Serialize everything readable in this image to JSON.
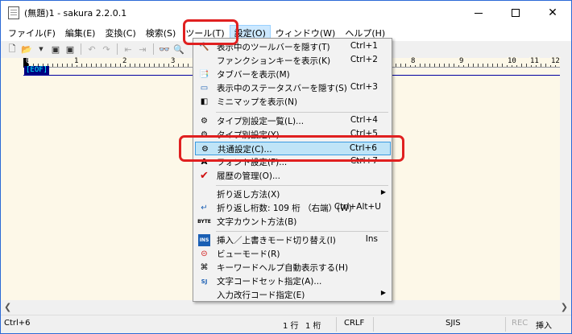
{
  "window": {
    "title": "(無題)1 - sakura 2.2.0.1"
  },
  "menubar": [
    "ファイル(F)",
    "編集(E)",
    "変換(C)",
    "検索(S)",
    "ツール(T)",
    "設定(O)",
    "ウィンドウ(W)",
    "ヘルプ(H)"
  ],
  "ruler": {
    "labels": [
      "0",
      "1",
      "2",
      "3",
      "8",
      "9",
      "10",
      "11",
      "12"
    ]
  },
  "editor": {
    "eof": "[EOF]"
  },
  "settings_menu": {
    "items": [
      {
        "label": "表示中のツールバーを隠す(T)",
        "shortcut": "Ctrl+1",
        "icon": "toolbar-icon"
      },
      {
        "label": "ファンクションキーを表示(K)",
        "shortcut": "Ctrl+2",
        "icon": ""
      },
      {
        "label": "タブバーを表示(M)",
        "shortcut": "",
        "icon": "tabbar-icon"
      },
      {
        "label": "表示中のステータスバーを隠す(S)",
        "shortcut": "Ctrl+3",
        "icon": "statusbar-icon"
      },
      {
        "label": "ミニマップを表示(N)",
        "shortcut": "",
        "icon": "minimap-icon"
      },
      {
        "label": "タイプ別設定一覧(L)...",
        "shortcut": "Ctrl+4",
        "icon": "type-list-icon"
      },
      {
        "label": "タイプ別設定(Y)...",
        "shortcut": "Ctrl+5",
        "icon": "type-settings-icon"
      },
      {
        "label": "共通設定(C)...",
        "shortcut": "Ctrl+6",
        "icon": "common-settings-icon"
      },
      {
        "label": "フォント設定(F)...",
        "shortcut": "Ctrl+7",
        "icon": "font-icon"
      },
      {
        "label": "履歴の管理(O)...",
        "shortcut": "",
        "icon": "checkmark-icon"
      },
      {
        "label": "折り返し方法(X)",
        "shortcut": "",
        "icon": "",
        "submenu": true
      },
      {
        "label": "折り返し桁数: 109 桁 （右端）(W)",
        "shortcut": "Ctrl+Alt+U",
        "icon": "wrap-icon"
      },
      {
        "label": "文字カウント方法(B)",
        "shortcut": "",
        "icon": "byte-icon"
      },
      {
        "label": "挿入／上書きモード切り替え(I)",
        "shortcut": "Ins",
        "icon": "ins-icon"
      },
      {
        "label": "ビューモード(R)",
        "shortcut": "",
        "icon": "viewmode-icon"
      },
      {
        "label": "キーワードヘルプ自動表示する(H)",
        "shortcut": "",
        "icon": "keyword-help-icon"
      },
      {
        "label": "文字コードセット指定(A)...",
        "shortcut": "",
        "icon": "charset-icon"
      },
      {
        "label": "入力改行コード指定(E)",
        "shortcut": "",
        "icon": "",
        "submenu": true
      }
    ],
    "highlighted_index": 7
  },
  "statusbar": {
    "message": "Ctrl+6",
    "line": "1 行",
    "col": "1 桁",
    "eol": "CRLF",
    "encoding": "SJIS",
    "rec": "REC",
    "mode": "挿入"
  },
  "colors": {
    "annotation": "#e02020",
    "highlight": "#bfe4f7",
    "editor_bg": "#fdf8e8",
    "eof_bg": "#000080",
    "eof_fg": "#00ffff"
  }
}
